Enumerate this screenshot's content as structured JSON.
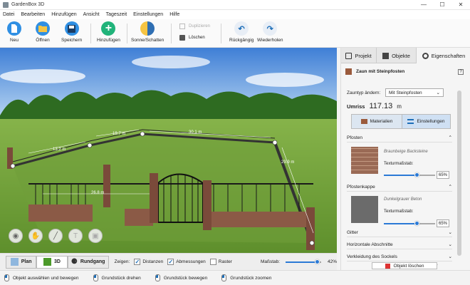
{
  "window": {
    "title": "GardenBox 3D"
  },
  "menu": [
    "Datei",
    "Bearbeiten",
    "Hinzufügen",
    "Ansicht",
    "Tageszeit",
    "Einstellungen",
    "Hilfe"
  ],
  "toolbar": {
    "neu": "Neu",
    "oeffnen": "Öffnen",
    "speichern": "Speichern",
    "hinzufuegen": "Hinzufügen",
    "sonne": "Sonne/Schatten",
    "duplizieren": "Duplizieren",
    "loeschen": "Löschen",
    "rueckgaengig": "Rückgängig",
    "wiederholen": "Wiederholen"
  },
  "dimensions": {
    "d1": "13.2 m",
    "d2": "19.7 m",
    "d3": "30.1 m",
    "d4": "29.9 m",
    "d5": "26.8 m"
  },
  "viewbar": {
    "plan": "Plan",
    "view3d": "3D",
    "rundgang": "Rundgang",
    "zeigen": "Zeigen:",
    "distanzen": "Distanzen",
    "abmessungen": "Abmessungen",
    "raster": "Raster",
    "massstab": "Maßstab:",
    "zoom_pct": "42%",
    "zoom_value": 0.9
  },
  "status": {
    "s1": "Objekt auswählen und bewegen",
    "s2": "Grundstück drehen",
    "s3": "Grundstück bewegen",
    "s4": "Grundstück zoomen"
  },
  "panel": {
    "tabs": {
      "projekt": "Projekt",
      "objekte": "Objekte",
      "eigenschaften": "Eigenschaften"
    },
    "object_title": "Zaun mit Steinpfosten",
    "zauntyp_label": "Zauntyp ändern:",
    "zauntyp_value": "Mit Steinpfosten",
    "umriss_label": "Umriss",
    "umriss_value": "117.13",
    "umriss_unit": "m",
    "materialien": "Materialien",
    "einstellungen": "Einstellungen",
    "pfosten": "Pfosten",
    "pfosten_material": "Braunbeige Backsteine",
    "texturmassstab": "Texturmaßstab:",
    "pfosten_pct": "65%",
    "pfosten_scale": 0.65,
    "pfostenkappe": "Pfostenkappe",
    "kappe_material": "Dunkelgrauer Beton",
    "kappe_pct": "65%",
    "kappe_scale": 0.65,
    "gitter": "Gitter",
    "horizontale": "Horizontale Abschnitte",
    "verkleidung": "Verkleidung des Sockels",
    "delete": "Objekt löschen"
  }
}
